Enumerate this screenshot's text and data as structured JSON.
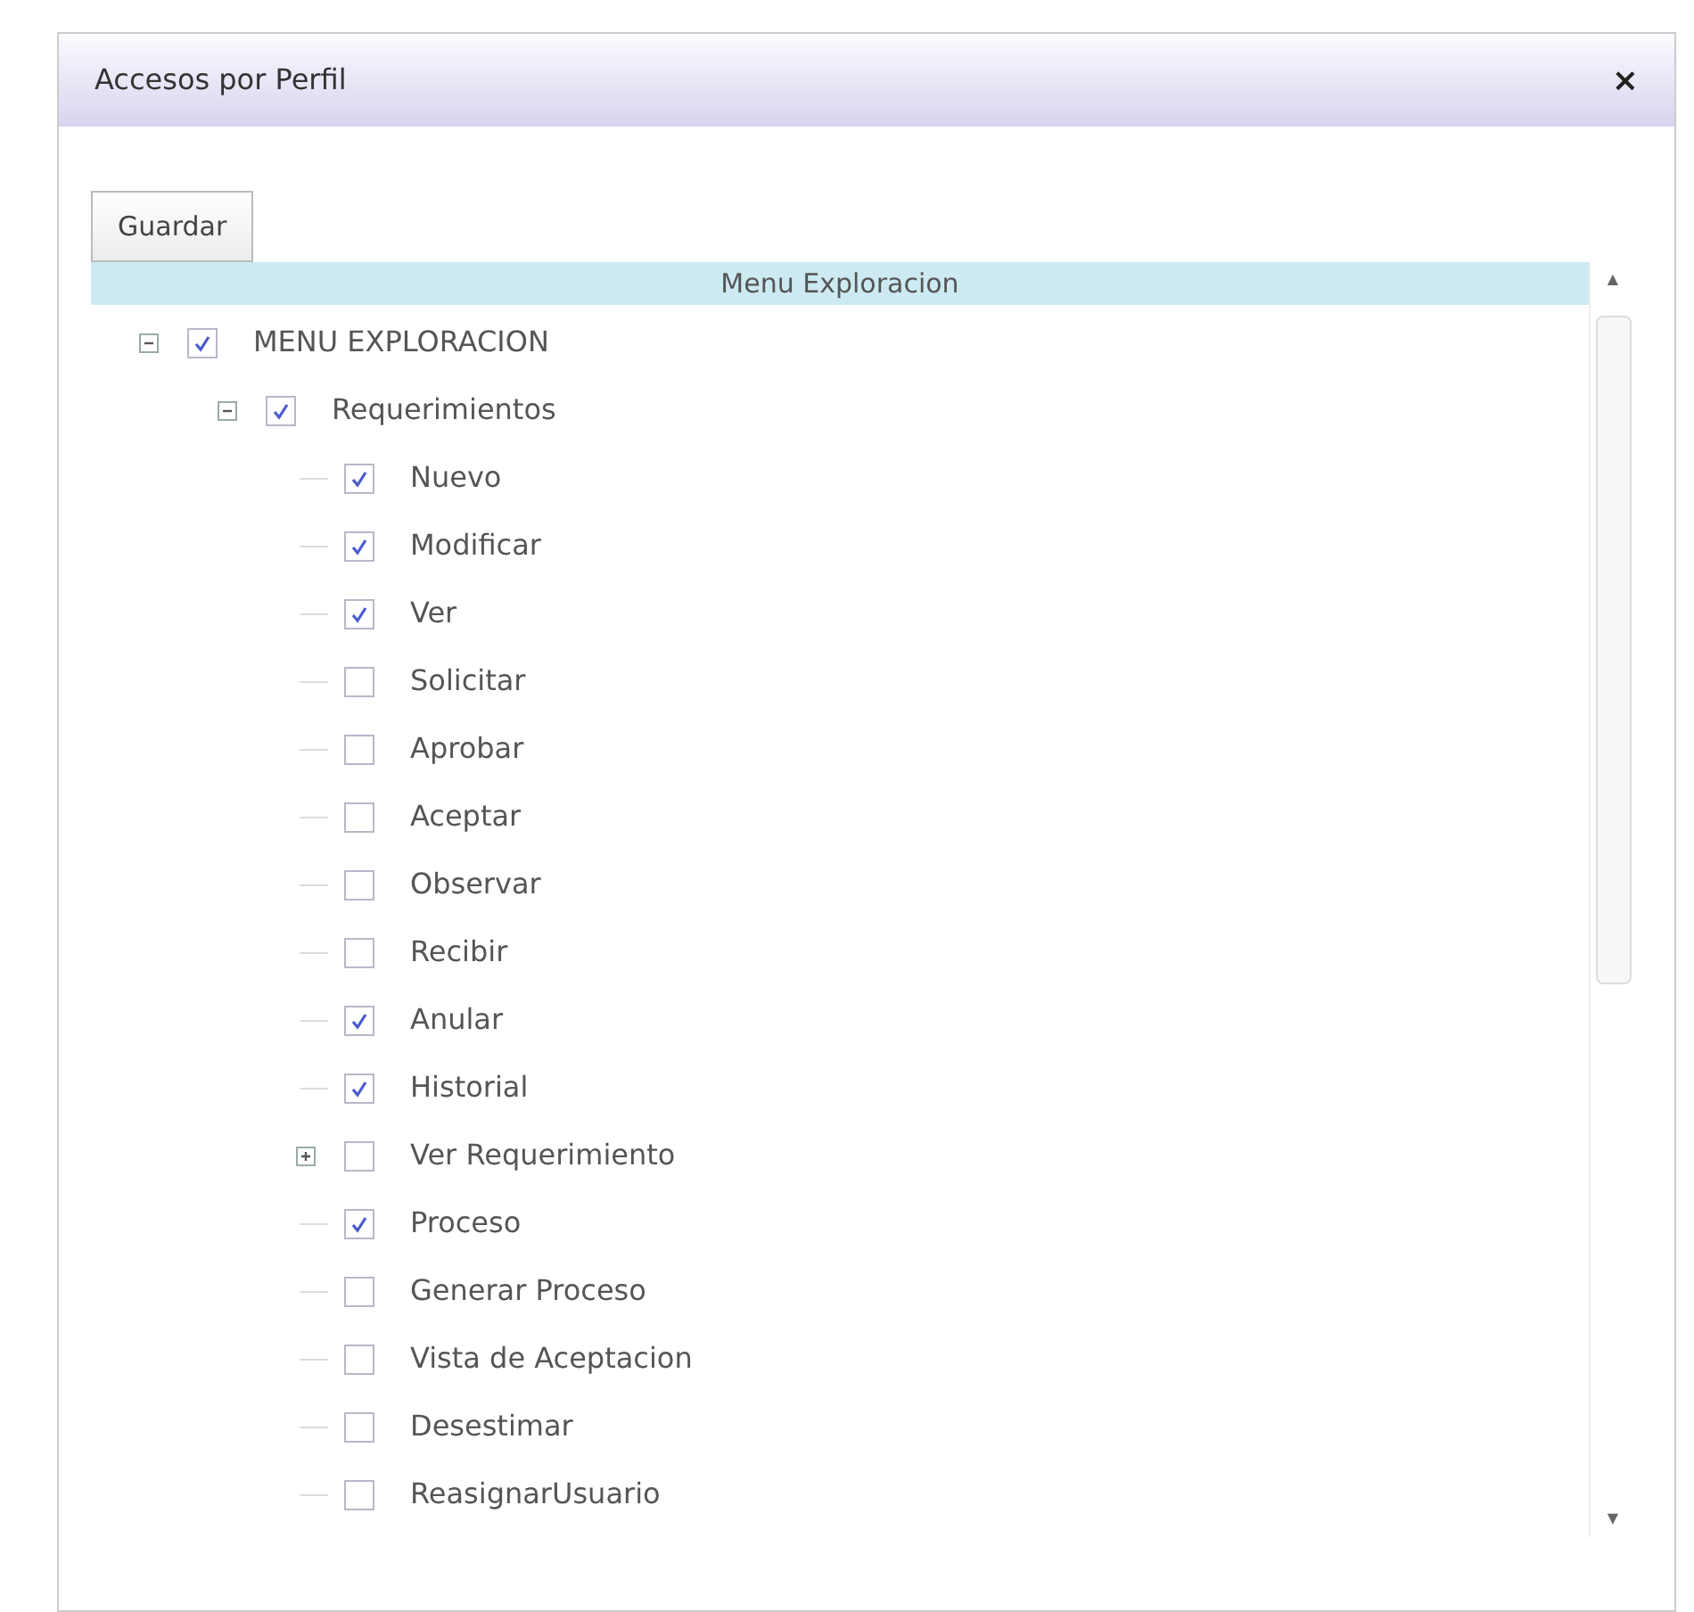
{
  "window": {
    "title": "Accesos por Perfil",
    "close": "×"
  },
  "toolbar": {
    "buttons": [
      "Guardar"
    ]
  },
  "tree": {
    "header": "Menu Exploracion",
    "scrollbar": {
      "up": "▲",
      "down": "▼"
    },
    "items": [
      {
        "label": "MENU EXPLORACION",
        "checked": true,
        "expanded": true,
        "children": [
          {
            "label": "Requerimientos",
            "checked": true,
            "expanded": true,
            "children": [
              {
                "label": "Nuevo",
                "checked": true
              },
              {
                "label": "Modificar",
                "checked": true
              },
              {
                "label": "Ver",
                "checked": true
              },
              {
                "label": "Solicitar",
                "checked": false
              },
              {
                "label": "Aprobar",
                "checked": false
              },
              {
                "label": "Aceptar",
                "checked": false
              },
              {
                "label": "Observar",
                "checked": false
              },
              {
                "label": "Recibir",
                "checked": false
              },
              {
                "label": "Anular",
                "checked": true
              },
              {
                "label": "Historial",
                "checked": true
              },
              {
                "label": "Ver Requerimiento",
                "checked": false,
                "expanded": false
              },
              {
                "label": "Proceso",
                "checked": true
              },
              {
                "label": "Generar Proceso",
                "checked": false
              },
              {
                "label": "Vista de Aceptacion",
                "checked": false
              },
              {
                "label": "Desestimar",
                "checked": false
              },
              {
                "label": "ReasignarUsuario",
                "checked": false
              }
            ]
          }
        ]
      }
    ]
  }
}
